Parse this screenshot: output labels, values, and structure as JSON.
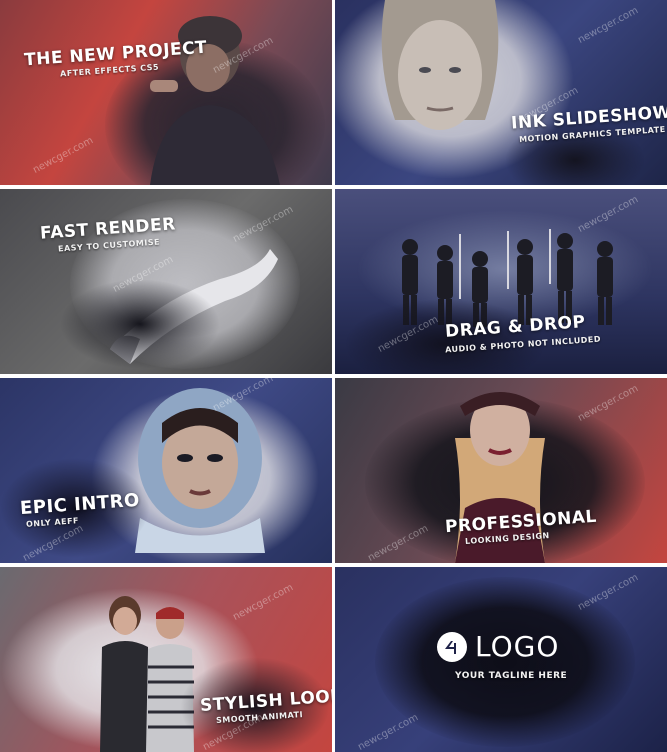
{
  "tiles": [
    {
      "title": "THE NEW PROJECT",
      "subtitle": "AFTER EFFECTS CS5"
    },
    {
      "title": "INK SLIDESHOW",
      "subtitle": "MOTION GRAPHICS TEMPLATE"
    },
    {
      "title": "FAST RENDER",
      "subtitle": "EASY TO CUSTOMISE"
    },
    {
      "title": "DRAG & DROP",
      "subtitle": "AUDIO & PHOTO NOT INCLUDED"
    },
    {
      "title": "EPIC INTRO",
      "subtitle": "ONLY AEFF"
    },
    {
      "title": "PROFESSIONAL",
      "subtitle": "LOOKING DESIGN"
    },
    {
      "title": "STYLISH LOOK",
      "subtitle": "SMOOTH ANIMATI"
    },
    {
      "logo_text": "LOGO",
      "subtitle": "YOUR TAGLINE HERE"
    }
  ],
  "watermark": "newcger.com",
  "colors": {
    "red": "#c4453f",
    "navy": "#2a3160",
    "gray": "#6b6b6b",
    "ink": "#14141c"
  }
}
